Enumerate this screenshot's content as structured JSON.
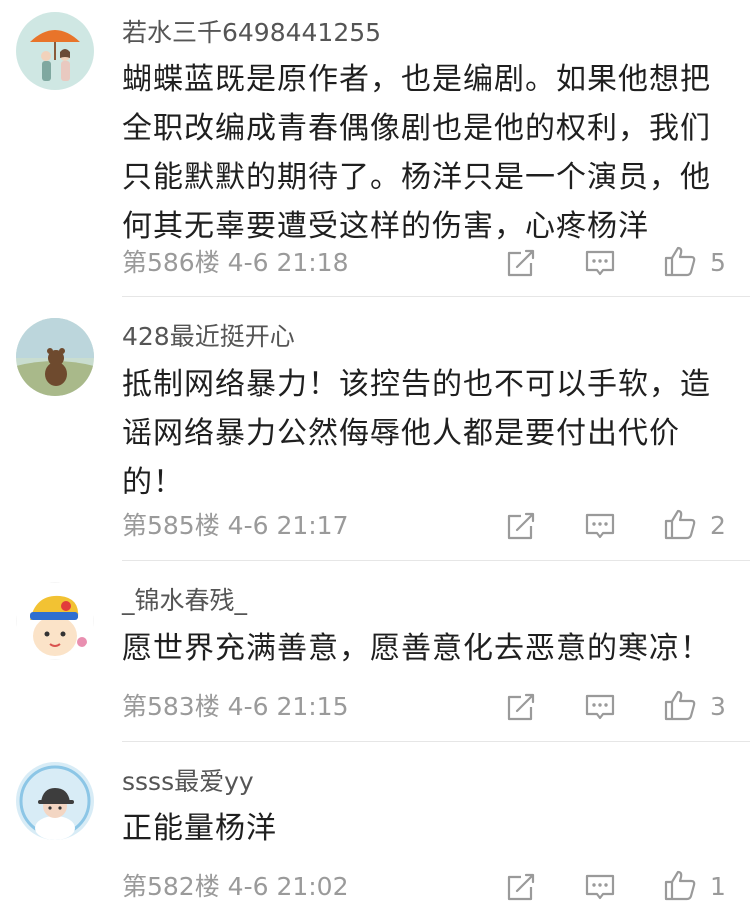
{
  "comments": [
    {
      "username": "若水三千6498441255",
      "lines": [
        "蝴蝶蓝既是原作者，也是编剧。如果他想把",
        "全职改编成青春偶像剧也是他的权利，我们",
        "只能默默的期待了。杨洋只是一个演员，他",
        "何其无辜要遭受这样的伤害，心疼杨洋"
      ],
      "floor": "第586楼",
      "time": "4-6 21:18",
      "likes": "5",
      "avatar": "umbrella-couple-avatar"
    },
    {
      "username": "428最近挺开心",
      "lines": [
        "抵制网络暴力！该控告的也不可以手软，造",
        "谣网络暴力公然侮辱他人都是要付出代价",
        "的！"
      ],
      "floor": "第585楼",
      "time": "4-6 21:17",
      "likes": "2",
      "avatar": "bear-landscape-avatar"
    },
    {
      "username": "_锦水春残_",
      "lines": [
        "愿世界充满善意，愿善意化去恶意的寒凉！"
      ],
      "floor": "第583楼",
      "time": "4-6 21:15",
      "likes": "3",
      "avatar": "cartoon-character-avatar"
    },
    {
      "username": "ssss最爱yy",
      "lines": [
        "正能量杨洋"
      ],
      "floor": "第582楼",
      "time": "4-6 21:02",
      "likes": "1",
      "avatar": "cap-boy-avatar"
    }
  ],
  "icons": {
    "share": "share-icon",
    "reply": "comment-icon",
    "like": "thumb-up-icon"
  },
  "colors": {
    "username": "#555555",
    "text": "#1f1f1f",
    "meta": "#9a9a9a",
    "divider": "#e6e6e6"
  }
}
